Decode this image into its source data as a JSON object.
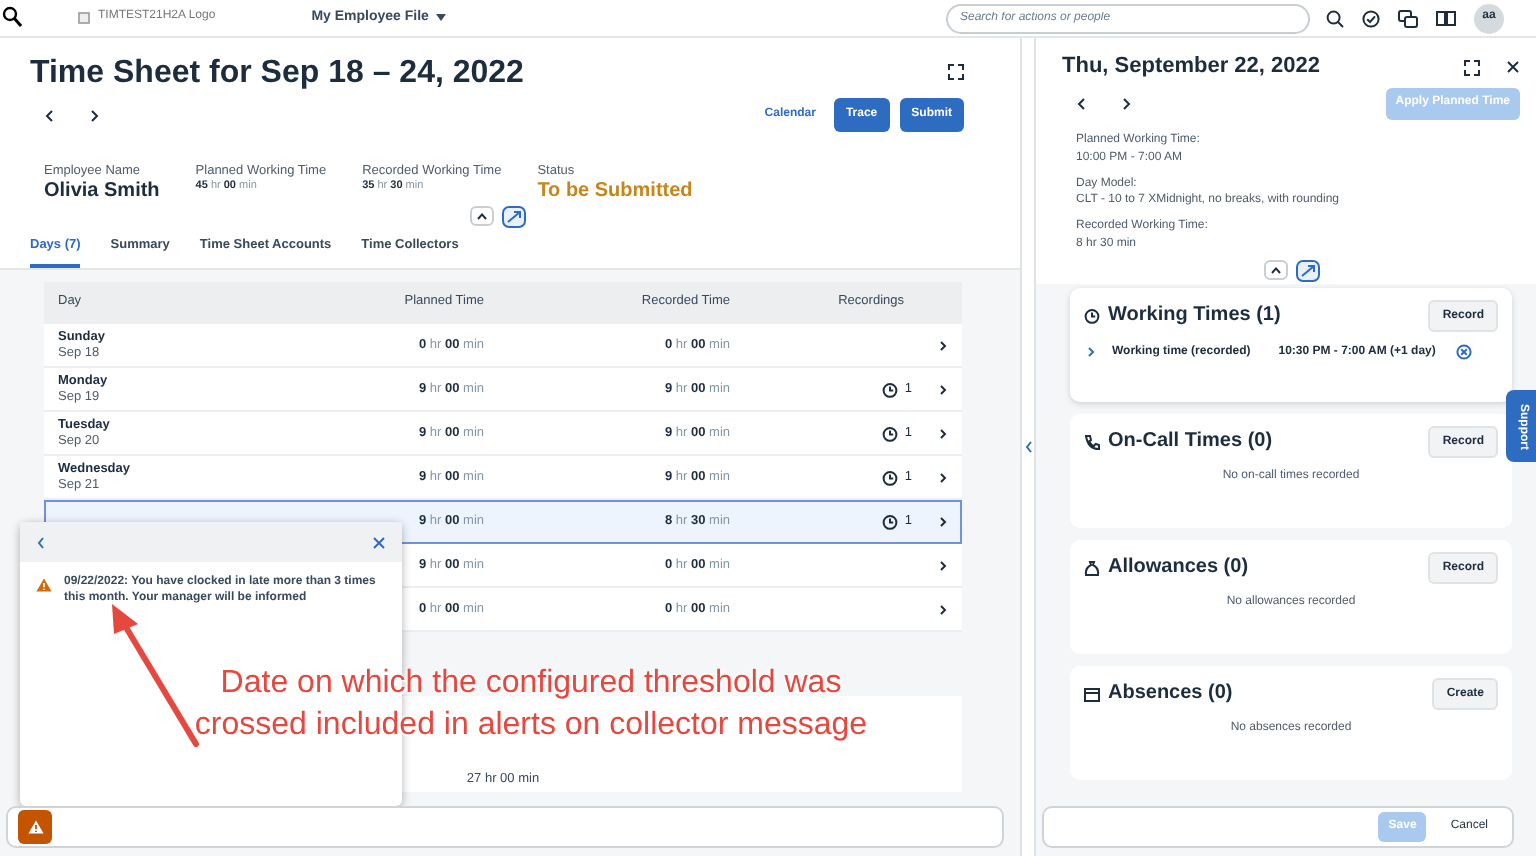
{
  "shell": {
    "logo_alt": "TIMTEST21H2A Logo",
    "app_menu": "My Employee File",
    "search": {
      "placeholder": "Search for actions or people"
    },
    "avatar": "aa"
  },
  "timesheet": {
    "title": "Time Sheet for Sep 18 – 24, 2022",
    "actions": [
      {
        "label": "Calendar",
        "kind": "link"
      },
      {
        "label": "Trace",
        "kind": "primary"
      },
      {
        "label": "Submit",
        "kind": "primary"
      }
    ],
    "attributes": [
      {
        "label": "Employee Name",
        "value": "Olivia Smith",
        "kind": "name"
      },
      {
        "label": "Planned Working Time",
        "value": "**45** hr **00** min",
        "kind": "time"
      },
      {
        "label": "Recorded Working Time",
        "value": "**35** hr **30** min",
        "kind": "time"
      },
      {
        "label": "Status",
        "value": "To be Submitted",
        "kind": "status"
      }
    ],
    "tabs": [
      {
        "label": "Days (7)",
        "selected": true
      },
      {
        "label": "Summary",
        "selected": false
      },
      {
        "label": "Time Sheet Accounts",
        "selected": false
      },
      {
        "label": "Time Collectors",
        "selected": false
      }
    ],
    "table": {
      "columns": [
        "Day",
        "Planned Time",
        "Recorded Time",
        "Recordings"
      ],
      "rows": [
        {
          "day": "Sunday",
          "date": "Sep 18",
          "planned": "**0** hr **00** min",
          "recorded": "**0** hr **00** min",
          "selected": false
        },
        {
          "day": "Monday",
          "date": "Sep 19",
          "planned": "**9** hr **00** min",
          "recorded": "**9** hr **00** min",
          "recordings": "1",
          "selected": false
        },
        {
          "day": "Tuesday",
          "date": "Sep 20",
          "planned": "**9** hr **00** min",
          "recorded": "**9** hr **00** min",
          "recordings": "1",
          "selected": false
        },
        {
          "day": "Wednesday",
          "date": "Sep 21",
          "planned": "**9** hr **00** min",
          "recorded": "**9** hr **00** min",
          "recordings": "1",
          "selected": false
        },
        {
          "planned": "**9** hr **00** min",
          "recorded": "**8** hr **30** min",
          "recordings": "1",
          "selected": true
        },
        {
          "planned": "**9** hr **00** min",
          "recorded": "**0** hr **00** min",
          "selected": false
        },
        {
          "planned": "**0** hr **00** min",
          "recorded": "**0** hr **00** min",
          "selected": false
        }
      ]
    },
    "total": "27 hr 00 min"
  },
  "popover": {
    "message": "09/22/2022: You have clocked in late more than 3 times this month. Your manager will be informed"
  },
  "annotation": {
    "text": "Date on which the configured threshold was crossed included in alerts on collector message"
  },
  "day_detail": {
    "title": "Thu, September 22, 2022",
    "apply_button": {
      "label": "Apply Planned Time",
      "disabled": true
    },
    "info": [
      {
        "label": "Planned Working Time:",
        "value": "10:00 PM - 7:00 AM"
      },
      {
        "label": "Day Model:",
        "value": "CLT - 10 to 7 XMidnight, no breaks, with rounding"
      },
      {
        "label": "Recorded Working Time:",
        "value": "8 hr 30 min"
      }
    ],
    "sections": [
      {
        "kind": "working",
        "title": "Working Times (1)",
        "button": "Record",
        "entries": [
          {
            "type": "Working time (recorded)",
            "time": "10:30 PM - 7:00 AM (+1 day)"
          }
        ]
      },
      {
        "kind": "oncall",
        "title": "On-Call Times (0)",
        "button": "Record",
        "empty": "No on-call times recorded"
      },
      {
        "kind": "allowance",
        "title": "Allowances (0)",
        "button": "Record",
        "empty": "No allowances recorded"
      },
      {
        "kind": "absence",
        "title": "Absences (0)",
        "button": "Create",
        "empty": "No absences recorded"
      }
    ],
    "footer": [
      {
        "label": "Save",
        "disabled": true
      },
      {
        "label": "Cancel",
        "disabled": false
      }
    ]
  },
  "support_tab": "Support"
}
